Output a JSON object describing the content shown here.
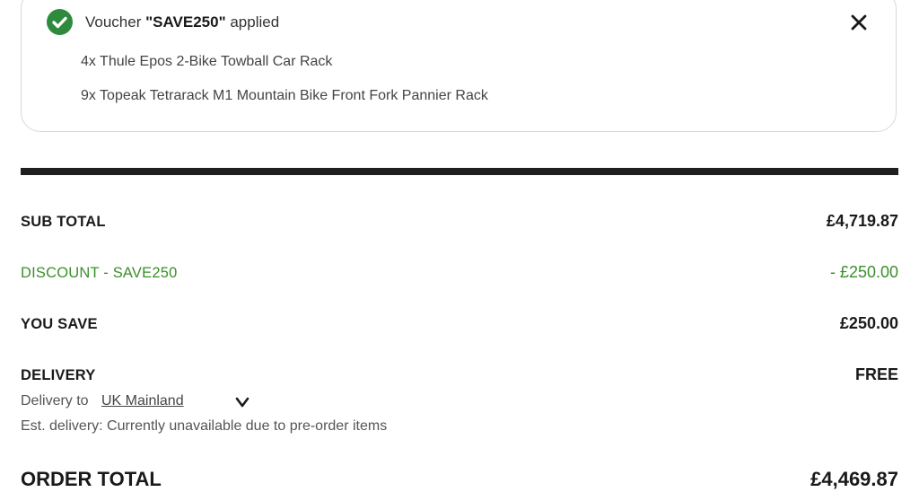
{
  "voucher": {
    "prefix": "Voucher ",
    "code": "\"SAVE250\"",
    "suffix": " applied",
    "items": [
      "4x Thule Epos 2-Bike Towball Car Rack",
      "9x Topeak Tetrarack M1 Mountain Bike Front Fork Pannier Rack"
    ]
  },
  "summary": {
    "subtotal_label": "SUB TOTAL",
    "subtotal_value": "£4,719.87",
    "discount_label": "DISCOUNT - SAVE250",
    "discount_value": "- £250.00",
    "yousave_label": "YOU SAVE",
    "yousave_value": "£250.00",
    "delivery_label": "DELIVERY",
    "delivery_value": "FREE",
    "delivery_to": "Delivery to",
    "delivery_region": "UK Mainland",
    "est_delivery": "Est. delivery: Currently unavailable due to pre-order items",
    "order_total_label": "ORDER TOTAL",
    "order_total_value": "£4,469.87"
  },
  "colors": {
    "success": "#2e8b3e",
    "discount": "#3a8f2a",
    "divider": "#1f1f1f"
  },
  "icons": {
    "check": "check-circle-icon",
    "close": "close-icon",
    "chevron": "chevron-down-icon"
  }
}
